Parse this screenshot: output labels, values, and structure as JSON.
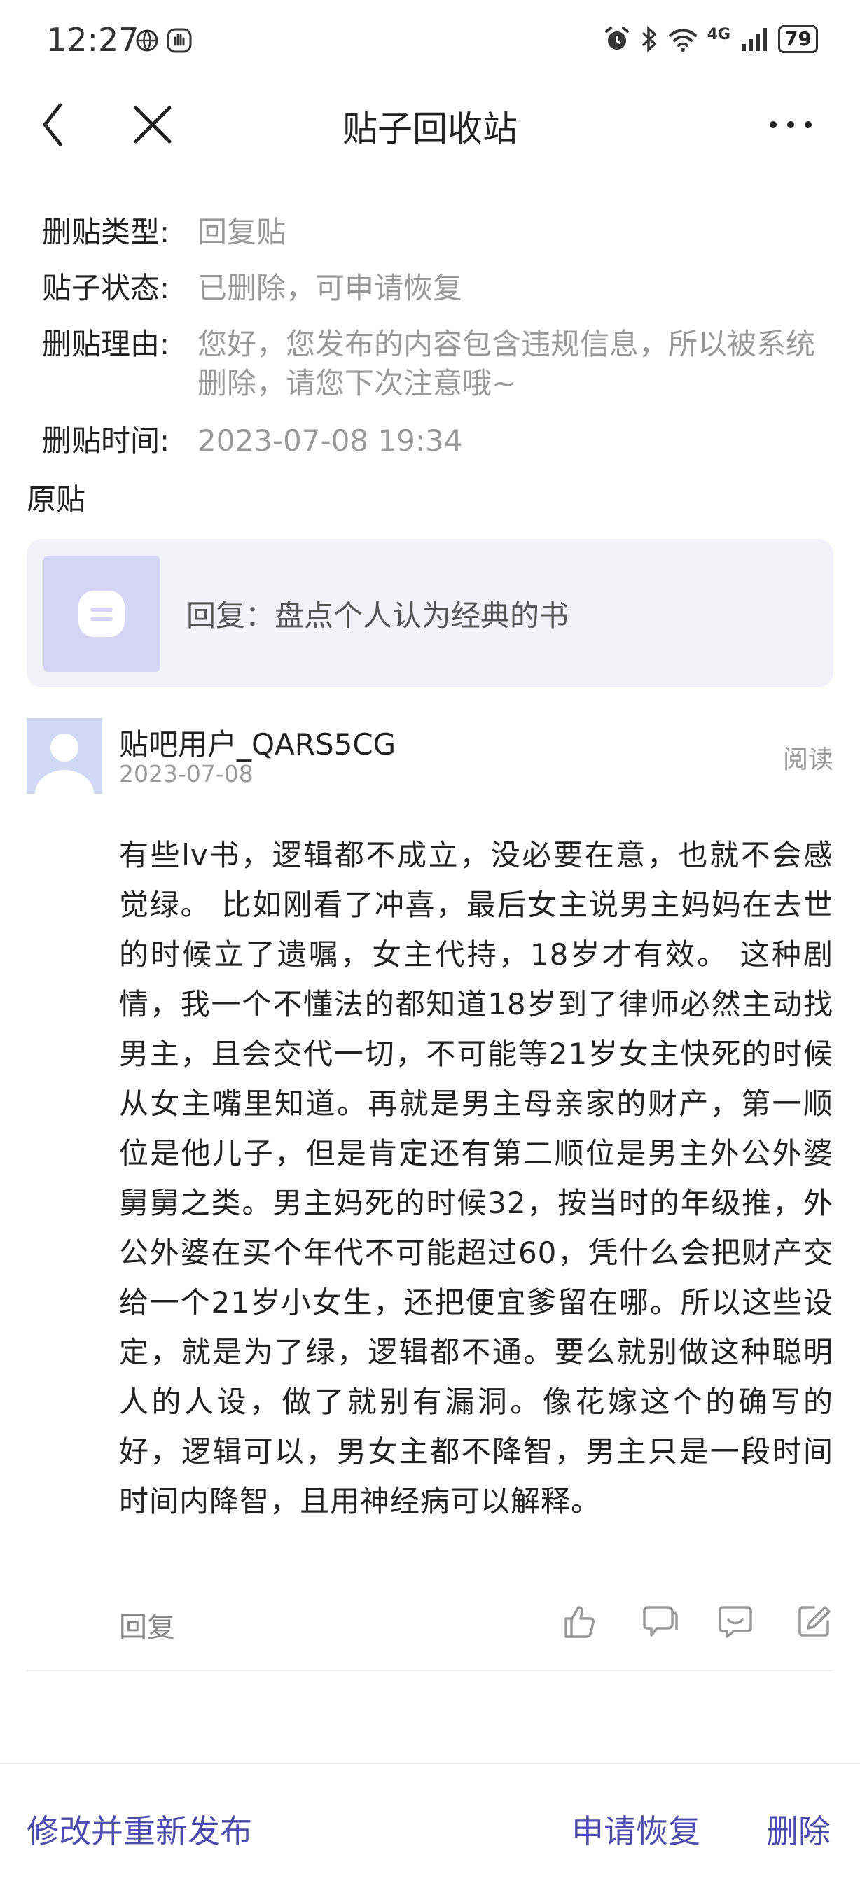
{
  "status_bar": {
    "time": "12:27",
    "network": "4G",
    "battery": "79"
  },
  "nav": {
    "title": "贴子回收站"
  },
  "info": {
    "type_label": "删贴类型:",
    "type_value": "回复贴",
    "status_label": "贴子状态:",
    "status_value": "已删除，可申请恢复",
    "reason_label": "删贴理由:",
    "reason_value": "您好，您发布的内容包含违规信息，所以被系统删除，请您下次注意哦~",
    "time_label": "删贴时间:",
    "time_value": "2023-07-08 19:34"
  },
  "original": {
    "section_title": "原贴",
    "card_text": "回复：盘点个人认为经典的书"
  },
  "post": {
    "username": "贴吧用户_QARS5CG",
    "date": "2023-07-08",
    "read_label": "阅读",
    "body": " 有些lv书，逻辑都不成立，没必要在意，也就不会感觉绿。 比如刚看了冲喜，最后女主说男主妈妈在去世的时候立了遗嘱，女主代持，18岁才有效。 这种剧情，我一个不懂法的都知道18岁到了律师必然主动找男主，且会交代一切，不可能等21岁女主快死的时候从女主嘴里知道。再就是男主母亲家的财产，第一顺位是他儿子，但是肯定还有第二顺位是男主外公外婆舅舅之类。男主妈死的时候32，按当时的年级推，外公外婆在买个年代不可能超过60，凭什么会把财产交给一个21岁小女生，还把便宜爹留在哪。所以这些设定，就是为了绿，逻辑都不通。要么就别做这种聪明人的人设，做了就别有漏洞。像花嫁这个的确写的好，逻辑可以，男女主都不降智，男主只是一段时间时间内降智，且用神经病可以解释。",
    "reply_label": "回复"
  },
  "bottom_bar": {
    "edit_label": "修改并重新发布",
    "restore_label": "申请恢复",
    "delete_label": "删除"
  },
  "colors": {
    "accent": "#4d4cac",
    "muted": "#999999",
    "card_bg": "#f3f2fa"
  },
  "icons": [
    "back-icon",
    "close-icon",
    "more-icon",
    "like-icon",
    "dislike-icon",
    "comment-icon",
    "edit-icon"
  ]
}
